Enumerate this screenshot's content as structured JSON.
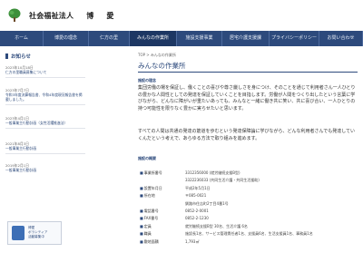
{
  "header": {
    "org_type": "社会福祉法人",
    "org_name_1": "博",
    "org_name_2": "愛"
  },
  "nav": {
    "items": [
      {
        "label": "ホーム"
      },
      {
        "label": "博愛の理念"
      },
      {
        "label": "仁方の里"
      },
      {
        "label": "みんなの作業所"
      },
      {
        "label": "施設支援事業"
      },
      {
        "label": "居宅介護支援課"
      },
      {
        "label": "プライバシーポリシー"
      },
      {
        "label": "お問い合わせ"
      }
    ]
  },
  "sidebar": {
    "heading": "お知らせ",
    "news": [
      {
        "date": "2023年10月18日",
        "title": "仁方の里職員募集について"
      },
      {
        "date": "2023年7月7日",
        "title": "令和3年度決算報告書、令和4年度現況報告書を掲載しました。"
      },
      {
        "date": "2023年4月1日",
        "title": "一般事業主行動計画（女性活躍推進法）"
      },
      {
        "date": "2021年8月3日",
        "title": "一般事業主行動計画"
      },
      {
        "date": "2019年2月1日",
        "title": "一般事業主行動計画"
      }
    ],
    "banner": {
      "line1": "博愛",
      "line2": "ボランティア",
      "line3": "活動募集中"
    }
  },
  "main": {
    "breadcrumb": "TOP > みんなの作業所",
    "title": "みんなの作業所",
    "section1_label": "施設の理念",
    "para1": "集団労働の場を保証し、働くことの喜びや尊さ厳しさを身につけ、そのことを通じて利用者さん一人ひとりの豊かな人間性としての発達を保証していくことを目指します。労働が人間をつくり出したという言葉に学びながら、どんなに障がいが重たいあっても、みんなと一緒に働き共に笑い、共に喜び合い、一人ひとりの持つ可能性を限りなく豊かに実らせたいと思います。",
    "para2": "すべての人間は共通の発達の筋道を歩むという発達保障論に学びながら、どんな利用者さんでも発達していくんだという考えで、あらゆる方法で取り組みを進めます。",
    "section2_label": "施設の概要",
    "rows": [
      {
        "k": "事業所番号",
        "v": "3312356000 (就労継続支援B型)"
      },
      {
        "k": "",
        "v": "3322236033 (共同生活介護・共同生活援助)"
      },
      {
        "k": "設置年月日",
        "v": "平成2年5月1日"
      },
      {
        "k": "所在地",
        "v": "〒085-0021"
      },
      {
        "k": "",
        "v": "釧路市住吉町2丁目4番1号"
      },
      {
        "k": "電話番号",
        "v": "0852-2-0001"
      },
      {
        "k": "FAX番号",
        "v": "0852-2-1230"
      },
      {
        "k": "定員",
        "v": "就労継続支援B型 30名、生活介護 6名"
      },
      {
        "k": "職員",
        "v": "施設長1名、サービス管理責任者1名、支援員6名、生活支援員1名、事務員1名"
      },
      {
        "k": "敷地面積",
        "v": "1,793㎡"
      }
    ]
  },
  "colors": {
    "brand": "#2d4a7c",
    "logo": "#3c8f3a"
  }
}
